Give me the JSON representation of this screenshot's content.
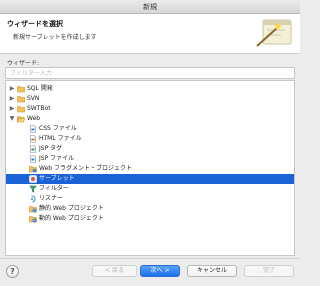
{
  "window": {
    "title": "新規"
  },
  "header": {
    "title": "ウィザードを選択",
    "description": "新規サーブレットを作成します"
  },
  "wizard_label": "ウィザード:",
  "filter": {
    "value": "",
    "placeholder": "フィルター入力"
  },
  "tree": {
    "items": [
      {
        "label": "SQL 開発",
        "expanded": false,
        "icon": "folder-icon"
      },
      {
        "label": "SVN",
        "expanded": false,
        "icon": "folder-icon"
      },
      {
        "label": "SWTBot",
        "expanded": false,
        "icon": "folder-icon"
      },
      {
        "label": "Web",
        "expanded": true,
        "icon": "folder-open-icon"
      },
      {
        "label": "CSS ファイル",
        "icon": "css-file-icon"
      },
      {
        "label": "HTML ファイル",
        "icon": "html-file-icon"
      },
      {
        "label": "JSP タグ",
        "icon": "jsp-tag-icon"
      },
      {
        "label": "JSP ファイル",
        "icon": "jsp-file-icon"
      },
      {
        "label": "Web フラグメント・プロジェクト",
        "icon": "web-fragment-project-icon"
      },
      {
        "label": "サーブレット",
        "icon": "servlet-icon",
        "selected": true
      },
      {
        "label": "フィルター",
        "icon": "filter-icon"
      },
      {
        "label": "リスナー",
        "icon": "listener-icon"
      },
      {
        "label": "静的 Web プロジェクト",
        "icon": "static-web-project-icon"
      },
      {
        "label": "動的 Web プロジェクト",
        "icon": "dynamic-web-project-icon"
      }
    ]
  },
  "buttons": {
    "help": "?",
    "back": "< 戻る",
    "next": "次へ >",
    "cancel": "キャンセル",
    "finish": "完了"
  },
  "colors": {
    "selection": "#1a62d6",
    "default_button": "#1d6ef0"
  }
}
